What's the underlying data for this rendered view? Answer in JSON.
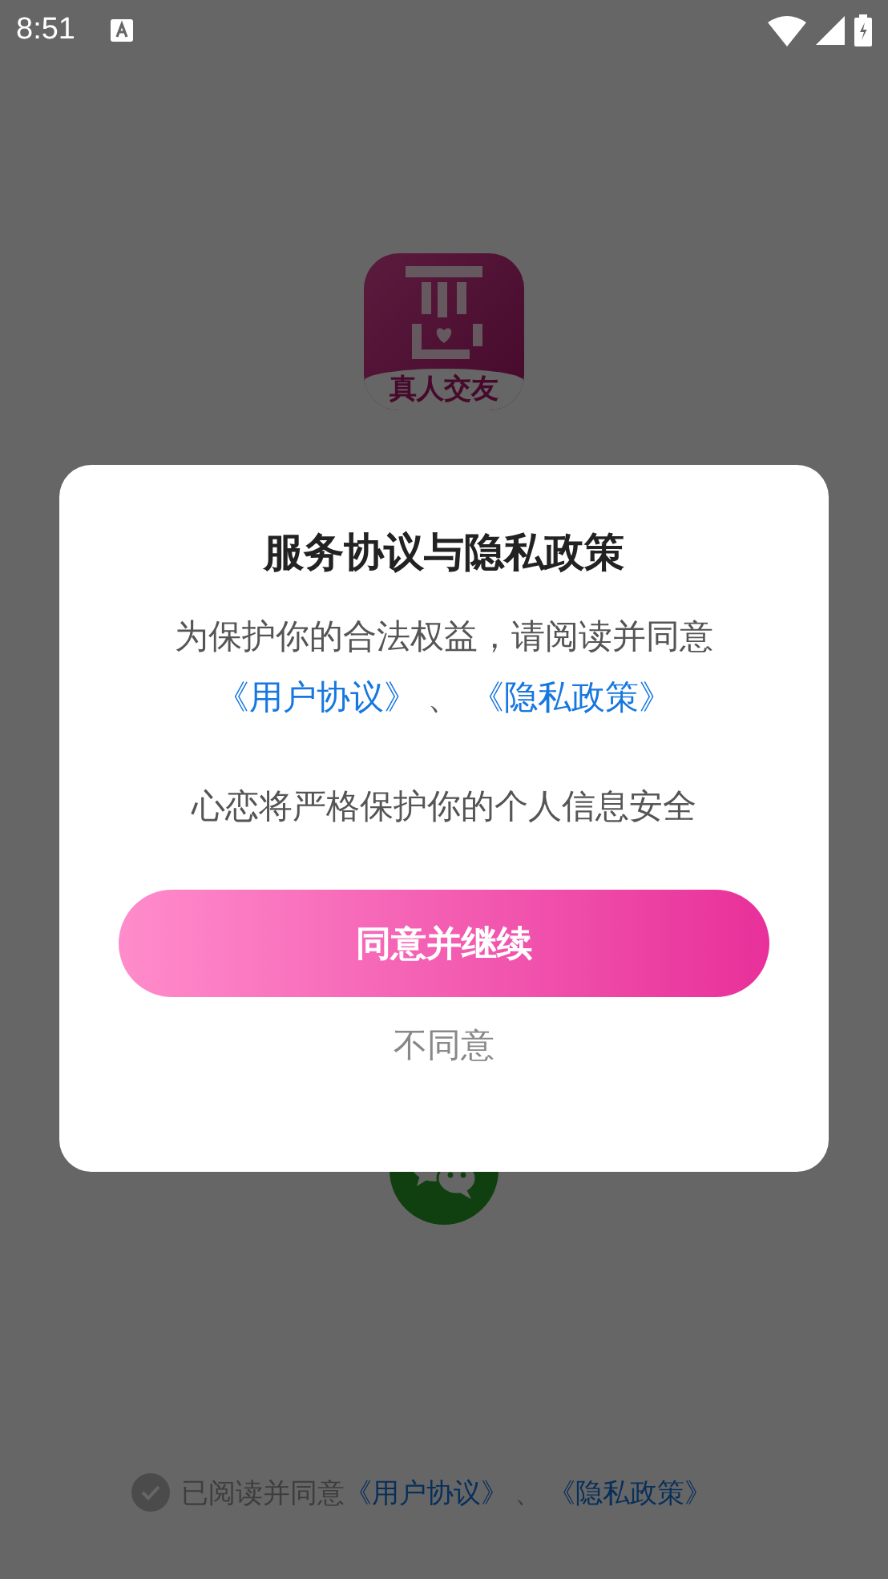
{
  "status_bar": {
    "time": "8:51"
  },
  "app_logo": {
    "caption": "真人交友"
  },
  "agreement": {
    "checked": false,
    "prefix": "已阅读并同意",
    "links": [
      "《用户协议》",
      "《隐私政策》"
    ],
    "separator": "、"
  },
  "dialog": {
    "title": "服务协议与隐私政策",
    "intro": "为保护你的合法权益，请阅读并同意",
    "links": [
      "《用户协议》",
      "《隐私政策》"
    ],
    "separator": "、",
    "note": "心恋将严格保护你的个人信息安全",
    "confirm": "同意并继续",
    "decline": "不同意"
  }
}
